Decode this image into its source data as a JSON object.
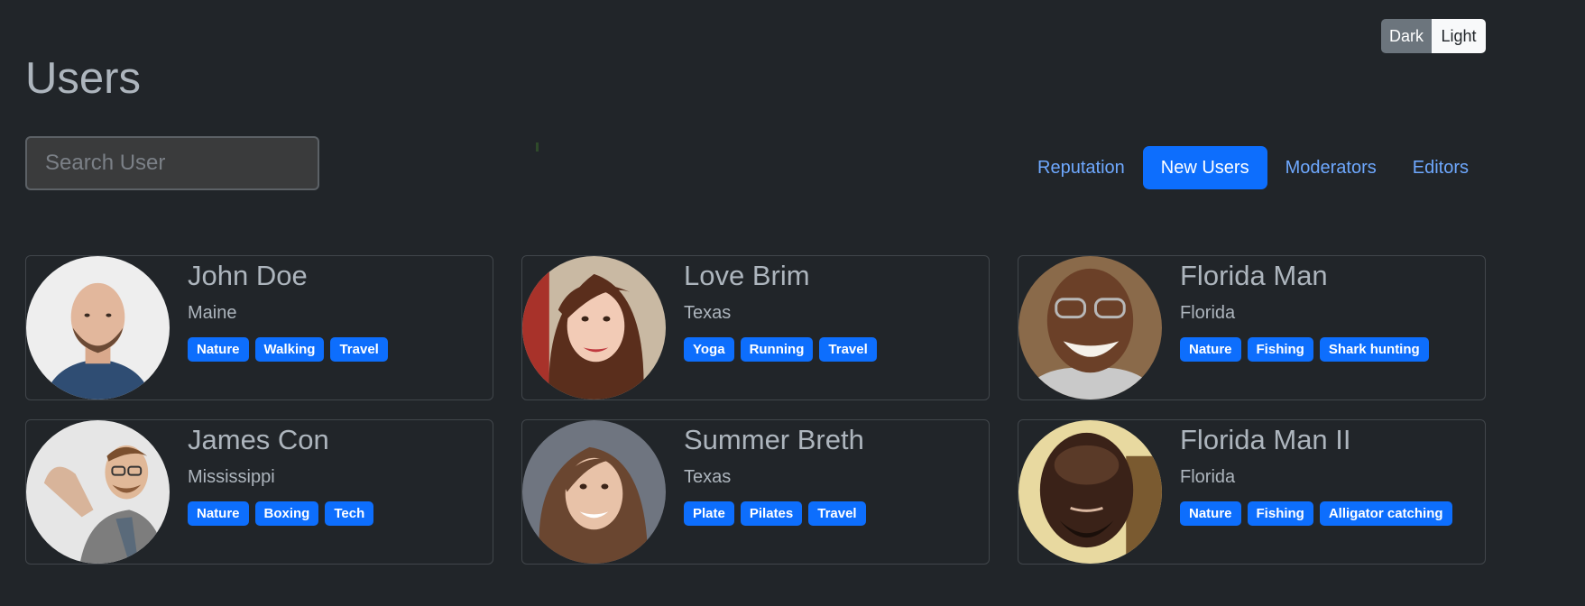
{
  "theme": {
    "dark_label": "Dark",
    "light_label": "Light",
    "selected": "Dark"
  },
  "page_title": "Users",
  "search": {
    "placeholder": "Search User",
    "value": ""
  },
  "tabs": [
    {
      "label": "Reputation",
      "active": false
    },
    {
      "label": "New Users",
      "active": true
    },
    {
      "label": "Moderators",
      "active": false
    },
    {
      "label": "Editors",
      "active": false
    }
  ],
  "users": [
    {
      "name": "John Doe",
      "location": "Maine",
      "tags": [
        "Nature",
        "Walking",
        "Travel"
      ],
      "avatar": "bald-bearded-man-photo"
    },
    {
      "name": "Love Brim",
      "location": "Texas",
      "tags": [
        "Yoga",
        "Running",
        "Travel"
      ],
      "avatar": "woman-brown-hair-photo"
    },
    {
      "name": "Florida Man",
      "location": "Florida",
      "tags": [
        "Nature",
        "Fishing",
        "Shark hunting"
      ],
      "avatar": "smiling-man-glasses-photo"
    },
    {
      "name": "James Con",
      "location": "Mississippi",
      "tags": [
        "Nature",
        "Boxing",
        "Tech"
      ],
      "avatar": "man-glasses-plaid-shirt-photo"
    },
    {
      "name": "Summer Breth",
      "location": "Texas",
      "tags": [
        "Plate",
        "Pilates",
        "Travel"
      ],
      "avatar": "woman-curly-hair-photo"
    },
    {
      "name": "Florida Man II",
      "location": "Florida",
      "tags": [
        "Nature",
        "Fishing",
        "Alligator catching"
      ],
      "avatar": "bald-man-selfie-photo"
    }
  ],
  "colors": {
    "background": "#212529",
    "accent": "#0d6efd",
    "link": "#6ea8fe",
    "text_muted": "#adb5bd",
    "card_border": "#41464b"
  }
}
